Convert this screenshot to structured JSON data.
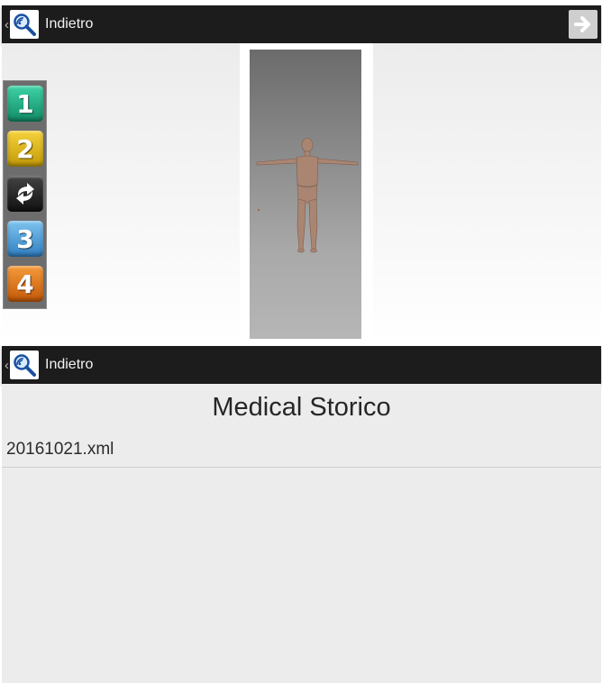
{
  "top_bar": {
    "back_label": "Indietro"
  },
  "steps": {
    "step1": "1",
    "step2": "2",
    "step3": "3",
    "step4": "4"
  },
  "bottom_bar": {
    "back_label": "Indietro"
  },
  "history": {
    "title": "Medical Storico",
    "files": [
      "20161021.xml"
    ]
  },
  "colors": {
    "bar_background": "#1c1c1c",
    "content_background": "#ececec",
    "step1": "#1fae84",
    "step2": "#e0b51a",
    "step3": "#4f9fd8",
    "step4": "#e5761e"
  },
  "icons": {
    "back": "chevron-left-icon",
    "logo": "app-logo-icon",
    "next": "arrow-right-icon",
    "rotate": "rotate-icon"
  }
}
